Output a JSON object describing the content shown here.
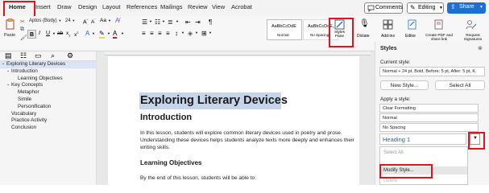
{
  "menubar": {
    "tabs": [
      "Home",
      "Insert",
      "Draw",
      "Design",
      "Layout",
      "References",
      "Mailings",
      "Review",
      "View",
      "Acrobat"
    ],
    "comments_label": "Comments",
    "editing_label": "Editing",
    "share_label": "Share"
  },
  "ribbon": {
    "paste_label": "Paste",
    "font_name": "Aptos (Body)",
    "font_size": "24",
    "style_normal_preview": "AaBbCcDdE",
    "style_normal_label": "Normal",
    "style_nospacing_preview": "AaBbCcDdE",
    "style_nospacing_label": "No Spacing",
    "styles_pane_label": "Styles Pane",
    "dictate_label": "Dictate",
    "addins_label": "Add-ins",
    "editor_label": "Editor",
    "create_pdf_label": "Create PDF and share link",
    "request_sig_label": "Request Signatures"
  },
  "nav": {
    "items": [
      {
        "label": "Exploring Literary Devices",
        "level": 0
      },
      {
        "label": "Introduction",
        "level": 1
      },
      {
        "label": "Learning Objectives",
        "level": 2
      },
      {
        "label": "Key Concepts",
        "level": 1
      },
      {
        "label": "Metaphor",
        "level": 2
      },
      {
        "label": "Simile",
        "level": 2
      },
      {
        "label": "Personification",
        "level": 2
      },
      {
        "label": "Vocabulary",
        "level": 1
      },
      {
        "label": "Practice Activity",
        "level": 1
      },
      {
        "label": "Conclusion",
        "level": 1
      }
    ]
  },
  "document": {
    "title": "Exploring Literary Devices",
    "h_intro": "Introduction",
    "intro_p": "In this lesson, students will explore common literary devices used in poetry and prose. Understanding these devices helps students analyze texts more deeply and enhances their writing skills.",
    "h_objectives": "Learning Objectives",
    "objectives_p": "By the end of this lesson, students will be able to:"
  },
  "styles_pane": {
    "title": "Styles",
    "current_label": "Current style:",
    "current_value": "Normal + 24 pt, Bold, Before: 5 pt, After: 5 pt, K",
    "new_style": "New Style...",
    "select_all": "Select All",
    "apply_label": "Apply a style:",
    "styles": [
      "Clear Formatting",
      "Normal",
      "No Spacing"
    ],
    "heading_value": "Heading 1",
    "menu_items": [
      "Select All",
      "Modify Style...",
      "Delete"
    ]
  }
}
